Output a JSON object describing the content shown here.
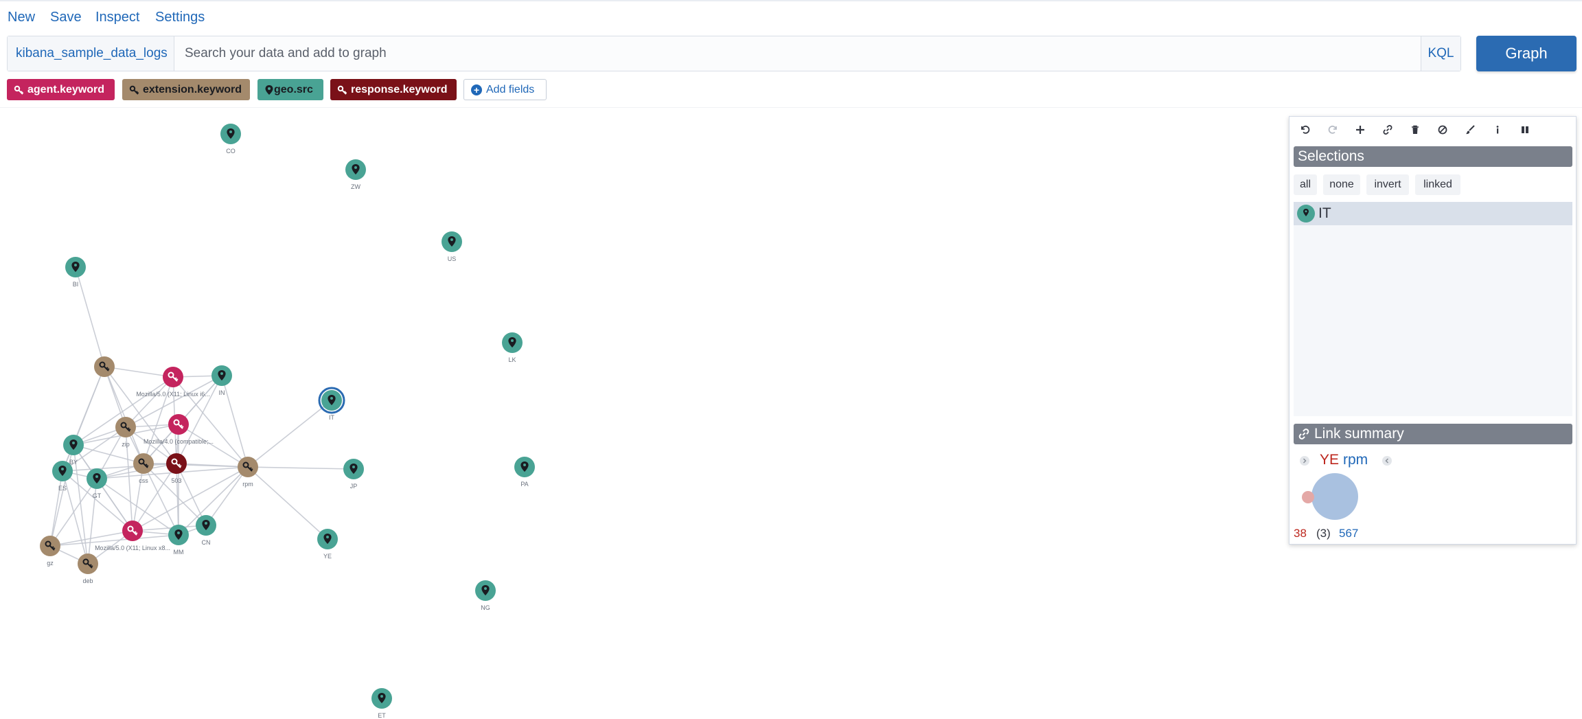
{
  "menu": {
    "new": "New",
    "save": "Save",
    "inspect": "Inspect",
    "settings": "Settings"
  },
  "search": {
    "index": "kibana_sample_data_logs",
    "placeholder": "Search your data and add to graph",
    "kql": "KQL",
    "graph_button": "Graph"
  },
  "fields": [
    {
      "label": "agent.keyword",
      "color": "#c4245e",
      "icon": "key-icon"
    },
    {
      "label": "extension.keyword",
      "color": "#a48a6c",
      "icon": "key-icon"
    },
    {
      "label": "geo.src",
      "color": "#49a394",
      "icon": "map-marker-icon"
    },
    {
      "label": "response.keyword",
      "color": "#7a1118",
      "icon": "key-icon"
    }
  ],
  "add_fields": "Add fields",
  "colors": {
    "agent": "#c4245e",
    "extension": "#a48a6c",
    "geo": "#49a394",
    "response": "#7a1118",
    "accent": "#2068b8",
    "edge": "#c2c6cf"
  },
  "graph": {
    "nodes": [
      {
        "id": "CO",
        "type": "geo",
        "label": "CO"
      },
      {
        "id": "ZW",
        "type": "geo",
        "label": "ZW"
      },
      {
        "id": "US",
        "type": "geo",
        "label": "US"
      },
      {
        "id": "BI",
        "type": "geo",
        "label": "BI"
      },
      {
        "id": "LK",
        "type": "geo",
        "label": "LK"
      },
      {
        "id": "ext1",
        "type": "extension",
        "label": ""
      },
      {
        "id": "ag1",
        "type": "agent",
        "label": "Mozilla/5.0 (X11; Linux i6..."
      },
      {
        "id": "IN",
        "type": "geo",
        "label": "IN"
      },
      {
        "id": "IT",
        "type": "geo",
        "label": "IT",
        "selected": true
      },
      {
        "id": "ag2",
        "type": "agent",
        "label": "Mozilla/4.0 (compatible;..."
      },
      {
        "id": "zip",
        "type": "extension",
        "label": "zip"
      },
      {
        "id": "BY",
        "type": "geo",
        "label": "BY"
      },
      {
        "id": "ES",
        "type": "geo",
        "label": "ES"
      },
      {
        "id": "GT",
        "type": "geo",
        "label": "GT"
      },
      {
        "id": "css",
        "type": "extension",
        "label": "css"
      },
      {
        "id": "503",
        "type": "response",
        "label": "503"
      },
      {
        "id": "rpm",
        "type": "extension",
        "label": "rpm"
      },
      {
        "id": "JP",
        "type": "geo",
        "label": "JP"
      },
      {
        "id": "PA",
        "type": "geo",
        "label": "PA"
      },
      {
        "id": "ag3",
        "type": "agent",
        "label": "Mozilla/5.0 (X11; Linux x8..."
      },
      {
        "id": "MM",
        "type": "geo",
        "label": "MM"
      },
      {
        "id": "CN",
        "type": "geo",
        "label": "CN"
      },
      {
        "id": "YE",
        "type": "geo",
        "label": "YE"
      },
      {
        "id": "gz",
        "type": "extension",
        "label": "gz"
      },
      {
        "id": "deb",
        "type": "extension",
        "label": "deb"
      },
      {
        "id": "NG",
        "type": "geo",
        "label": "NG"
      },
      {
        "id": "ET",
        "type": "geo",
        "label": "ET"
      }
    ],
    "edges": [
      [
        "BI",
        "ext1"
      ],
      [
        "ext1",
        "ag1"
      ],
      [
        "ext1",
        "zip"
      ],
      [
        "ext1",
        "BY"
      ],
      [
        "ext1",
        "css"
      ],
      [
        "ext1",
        "503"
      ],
      [
        "ext1",
        "ES"
      ],
      [
        "ag1",
        "IN"
      ],
      [
        "ag1",
        "zip"
      ],
      [
        "ag1",
        "css"
      ],
      [
        "ag1",
        "BY"
      ],
      [
        "ag1",
        "503"
      ],
      [
        "ag1",
        "rpm"
      ],
      [
        "IN",
        "rpm"
      ],
      [
        "IN",
        "zip"
      ],
      [
        "IN",
        "css"
      ],
      [
        "IN",
        "503"
      ],
      [
        "IN",
        "ag2"
      ],
      [
        "IT",
        "rpm"
      ],
      [
        "rpm",
        "JP"
      ],
      [
        "rpm",
        "YE"
      ],
      [
        "rpm",
        "503"
      ],
      [
        "rpm",
        "css"
      ],
      [
        "rpm",
        "MM"
      ],
      [
        "rpm",
        "CN"
      ],
      [
        "rpm",
        "ag3"
      ],
      [
        "rpm",
        "GT"
      ],
      [
        "rpm",
        "ag2"
      ],
      [
        "ag2",
        "zip"
      ],
      [
        "ag2",
        "css"
      ],
      [
        "ag2",
        "503"
      ],
      [
        "ag2",
        "BY"
      ],
      [
        "ag2",
        "MM"
      ],
      [
        "zip",
        "BY"
      ],
      [
        "zip",
        "ES"
      ],
      [
        "zip",
        "GT"
      ],
      [
        "zip",
        "css"
      ],
      [
        "zip",
        "503"
      ],
      [
        "zip",
        "ag3"
      ],
      [
        "BY",
        "ES"
      ],
      [
        "BY",
        "GT"
      ],
      [
        "BY",
        "css"
      ],
      [
        "BY",
        "ag3"
      ],
      [
        "BY",
        "gz"
      ],
      [
        "BY",
        "deb"
      ],
      [
        "ES",
        "GT"
      ],
      [
        "ES",
        "gz"
      ],
      [
        "ES",
        "deb"
      ],
      [
        "ES",
        "ag3"
      ],
      [
        "ES",
        "503"
      ],
      [
        "GT",
        "css"
      ],
      [
        "GT",
        "503"
      ],
      [
        "GT",
        "ag3"
      ],
      [
        "GT",
        "MM"
      ],
      [
        "GT",
        "gz"
      ],
      [
        "GT",
        "deb"
      ],
      [
        "css",
        "503"
      ],
      [
        "css",
        "ag3"
      ],
      [
        "css",
        "MM"
      ],
      [
        "css",
        "CN"
      ],
      [
        "503",
        "ag3"
      ],
      [
        "503",
        "MM"
      ],
      [
        "503",
        "CN"
      ],
      [
        "ag3",
        "MM"
      ],
      [
        "ag3",
        "CN"
      ],
      [
        "ag3",
        "gz"
      ],
      [
        "ag3",
        "deb"
      ],
      [
        "MM",
        "CN"
      ],
      [
        "MM",
        "gz"
      ],
      [
        "gz",
        "deb"
      ]
    ]
  },
  "panel": {
    "selections_title": "Selections",
    "sel_buttons": [
      "all",
      "none",
      "invert",
      "linked"
    ],
    "selected_items": [
      {
        "label": "IT",
        "type": "geo"
      }
    ],
    "link_summary_title": "Link summary",
    "link_from": "YE",
    "link_to": "rpm",
    "count_left": "38",
    "count_mid": "(3)",
    "count_right": "567"
  }
}
